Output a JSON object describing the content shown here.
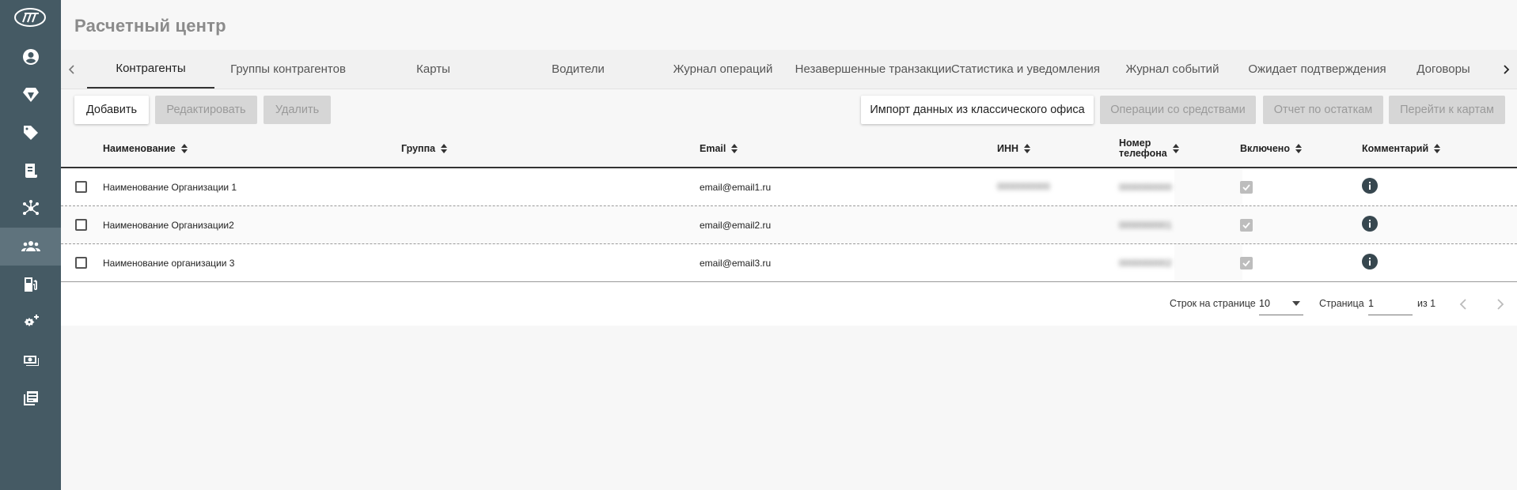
{
  "header": {
    "title": "Расчетный центр"
  },
  "tabs": [
    {
      "label": "Контрагенты"
    },
    {
      "label": "Группы контрагентов"
    },
    {
      "label": "Карты"
    },
    {
      "label": "Водители"
    },
    {
      "label": "Журнал операций"
    },
    {
      "label": "Незавершенные транзакции"
    },
    {
      "label": "Статистика и уведомления"
    },
    {
      "label": "Журнал событий"
    },
    {
      "label": "Ожидает подтверждения"
    },
    {
      "label": "Договоры"
    }
  ],
  "toolbar": {
    "add": "Добавить",
    "edit": "Редактировать",
    "delete": "Удалить",
    "import": "Импорт данных из классического офиса",
    "funds": "Операции со средствами",
    "balance_report": "Отчет по остаткам",
    "go_to_cards": "Перейти к картам"
  },
  "table": {
    "columns": {
      "name": "Наименование",
      "group": "Группа",
      "email": "Email",
      "inn": "ИНН",
      "phone_line1": "Номер",
      "phone_line2": "телефона",
      "enabled": "Включено",
      "comment": "Комментарий"
    },
    "rows": [
      {
        "name": "Наименование Организации 1",
        "group": "",
        "email": "email@email1.ru",
        "inn": "0000000000",
        "phone": "0000000000"
      },
      {
        "name": "Наименование Организации2",
        "group": "",
        "email": "email@email2.ru",
        "inn": "",
        "phone": "0000000001"
      },
      {
        "name": "Наименование организации 3",
        "group": "",
        "email": "email@email3.ru",
        "inn": "",
        "phone": "0000000002"
      }
    ]
  },
  "pagination": {
    "rows_per_page_label": "Строк на странице",
    "rows_per_page": "10",
    "page_label": "Страница",
    "page": "1",
    "of_label": "из 1"
  },
  "colors": {
    "sidebar": "#455a64",
    "sidebar_active": "#5f737d",
    "accent": "#333333"
  }
}
